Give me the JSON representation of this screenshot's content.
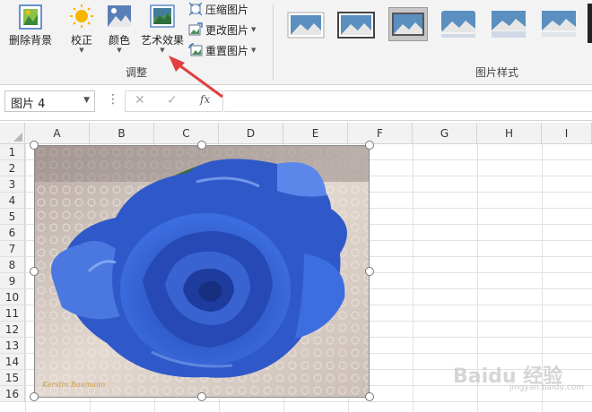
{
  "ribbon": {
    "remove_background": "删除背景",
    "corrections": "校正",
    "color": "颜色",
    "artistic_effects": "艺术效果",
    "compress_pictures": "压缩图片",
    "change_picture": "更改图片",
    "reset_picture": "重置图片",
    "adjust_group": "调整",
    "styles_group": "图片样式"
  },
  "formula_bar": {
    "name_box": "图片 4",
    "fx": "fx"
  },
  "grid": {
    "columns": [
      "A",
      "B",
      "C",
      "D",
      "E",
      "F",
      "G",
      "H",
      "I"
    ],
    "rows": [
      "1",
      "2",
      "3",
      "4",
      "5",
      "6",
      "7",
      "8",
      "9",
      "10",
      "11",
      "12",
      "13",
      "14",
      "15",
      "16"
    ]
  },
  "picture": {
    "signature": "Kerstin Baumann"
  },
  "watermark": {
    "text": "Baidu 经验",
    "sub": "jingyan.baidu.com"
  },
  "colors": {
    "ribbon_bg": "#f3f3f3",
    "annotation_arrow": "#e04040",
    "rose_blue": "#2f59c9"
  }
}
